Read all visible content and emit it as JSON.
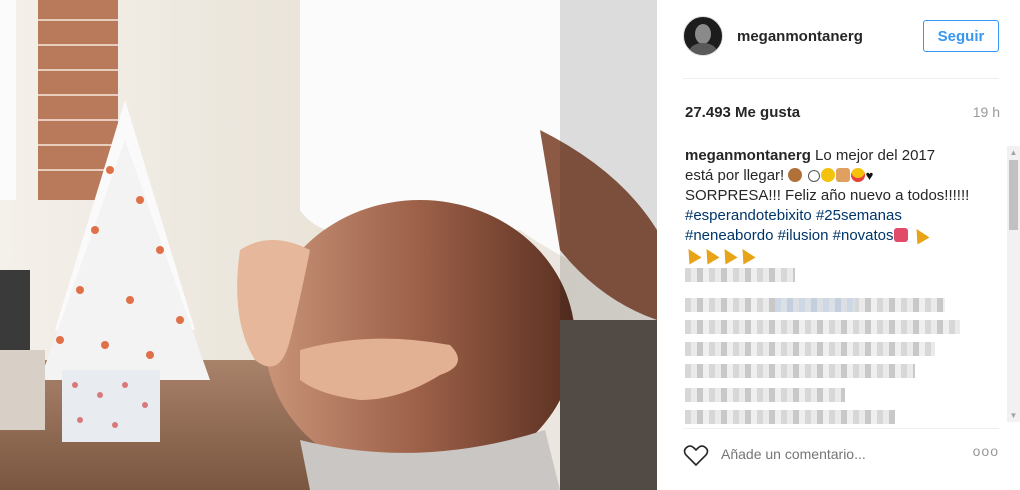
{
  "post": {
    "username": "meganmontanerg",
    "follow_label": "Seguir",
    "likes": "27.493 Me gusta",
    "time": "19 h",
    "caption": {
      "user": "meganmontanerg",
      "line1": " Lo mejor del 2017",
      "line2": "está por llegar! ",
      "line3": "SORPRESA!!! Feliz año nuevo a todos!!!!!!",
      "tag1": "#esperandotebixito",
      "tag2": "#25semanas",
      "tag3": "#neneabordo",
      "tag4": "#ilusion",
      "tag5": "#novatos"
    },
    "comment_placeholder": "Añade un comentario...",
    "more_label": "ooo"
  },
  "icons": [
    "avatar",
    "heart-icon",
    "more-options-icon",
    "scroll-up-icon",
    "scroll-down-icon"
  ]
}
